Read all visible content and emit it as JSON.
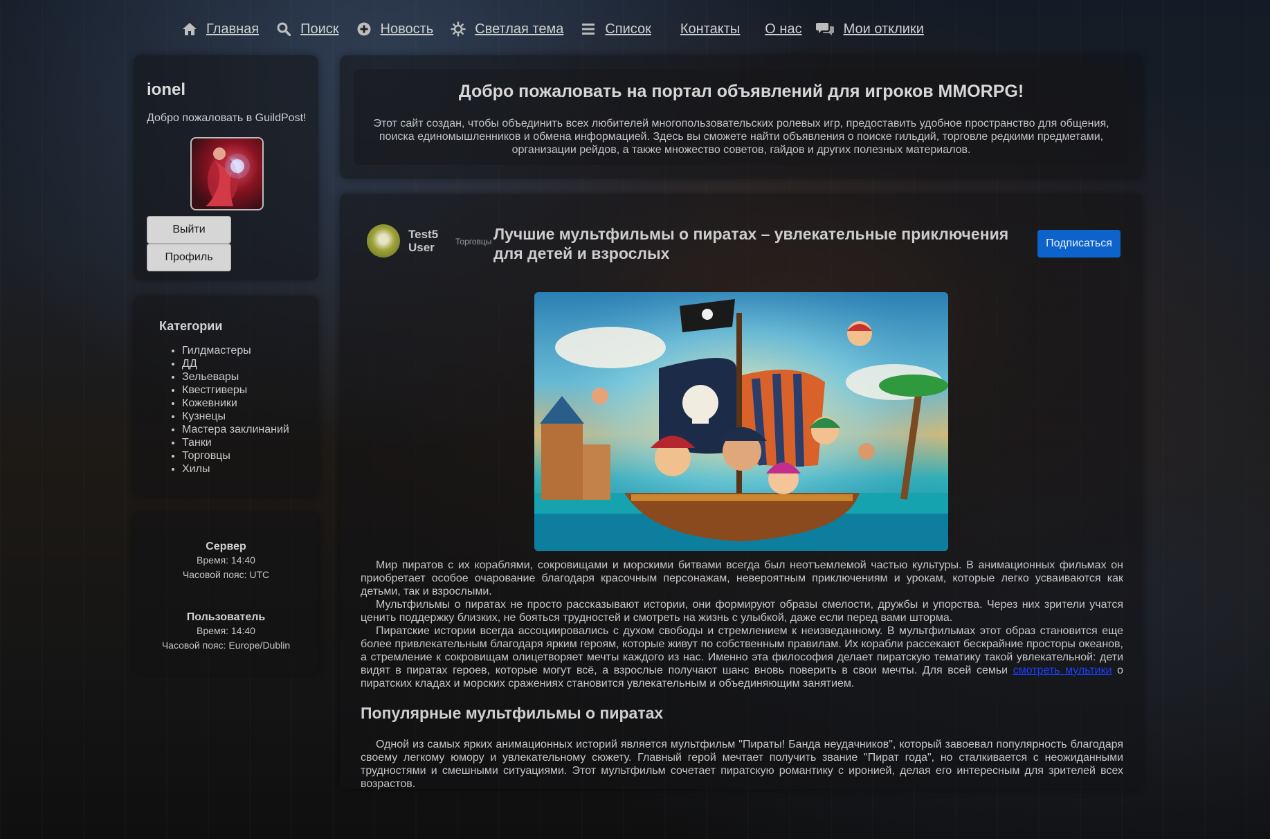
{
  "nav": {
    "items": [
      {
        "label": "Главная",
        "icon": "home-icon"
      },
      {
        "label": "Поиск",
        "icon": "search-icon"
      },
      {
        "label": "Новость",
        "icon": "plus-circle-icon"
      },
      {
        "label": "Светлая тема",
        "icon": "sun-icon"
      },
      {
        "label": "Список",
        "icon": "list-icon"
      },
      {
        "label": "Контакты",
        "icon": null
      },
      {
        "label": "О нас",
        "icon": null
      },
      {
        "label": "Мои отклики",
        "icon": "comments-icon"
      }
    ]
  },
  "profile": {
    "username": "ionel",
    "welcome": "Добро пожаловать в GuildPost!",
    "logout_label": "Выйти",
    "profile_label": "Профиль"
  },
  "categories": {
    "title": "Категории",
    "items": [
      "Гилдмастеры",
      "ДД",
      "Зельевары",
      "Квестгиверы",
      "Кожевники",
      "Кузнецы",
      "Мастера заклинаний",
      "Танки",
      "Торговцы",
      "Хилы"
    ]
  },
  "time": {
    "server_title": "Сервер",
    "server_time": "Время: 14:40",
    "server_tz": "Часовой пояс: UTC",
    "user_title": "Пользователь",
    "user_time": "Время: 14:40",
    "user_tz": "Часовой пояс: Europe/Dublin"
  },
  "hero": {
    "title": "Добро пожаловать на портал объявлений для игроков MMORPG!",
    "text": "Этот сайт создан, чтобы объединить всех любителей многопользовательских ролевых игр, предоставить удобное пространство для общения, поиска единомышленников и обмена информацией. Здесь вы сможете найти объявления о поиске гильдий, торговле редкими предметами, организации рейдов, а также множество советов, гайдов и других полезных материалов."
  },
  "article": {
    "author_name": "Test5 User",
    "author_category": "Торговцы",
    "title": "Лучшие мультфильмы о пиратах – увлекательные приключения для детей и взрослых",
    "subscribe_label": "Подписаться",
    "p1": "Мир пиратов с их кораблями, сокровищами и морскими битвами всегда был неотъемлемой частью культуры. В анимационных фильмах он приобретает особое очарование благодаря красочным персонажам, невероятным приключениям и урокам, которые легко усваиваются как детьми, так и взрослыми.",
    "p2": "Мультфильмы о пиратах не просто рассказывают истории, они формируют образы смелости, дружбы и упорства. Через них зрители учатся ценить поддержку близких, не бояться трудностей и смотреть на жизнь с улыбкой, даже если перед вами шторма.",
    "p3_before": "Пиратские истории всегда ассоциировались с духом свободы и стремлением к неизведанному. В мультфильмах этот образ становится еще более привлекательным благодаря ярким героям, которые живут по собственным правилам. Их корабли рассекают бескрайние просторы океанов, а стремление к сокровищам олицетворяет мечты каждого из нас. Именно эта философия делает пиратскую тематику такой увлекательной: дети видят в пиратах героев, которые могут всё, а взрослые получают шанс вновь поверить в свои мечты. Для всей семьи ",
    "p3_link": "смотреть мультики",
    "p3_after": " о пиратских кладах и морских сражениях становится увлекательным и объединяющим занятием.",
    "subheading": "Популярные мультфильмы о пиратах",
    "p4": "Одной из самых ярких анимационных историй является мультфильм \"Пираты! Банда неудачников\", который завоевал популярность благодаря своему легкому юмору и увлекательному сюжету. Главный герой мечтает получить звание \"Пират года\", но сталкивается с неожиданными трудностями и смешными ситуациями. Этот мультфильм сочетает пиратскую романтику с иронией, делая его интересным для зрителей всех возрастов."
  },
  "colors": {
    "accent": "#0d62cc",
    "link": "#1c3fff"
  }
}
